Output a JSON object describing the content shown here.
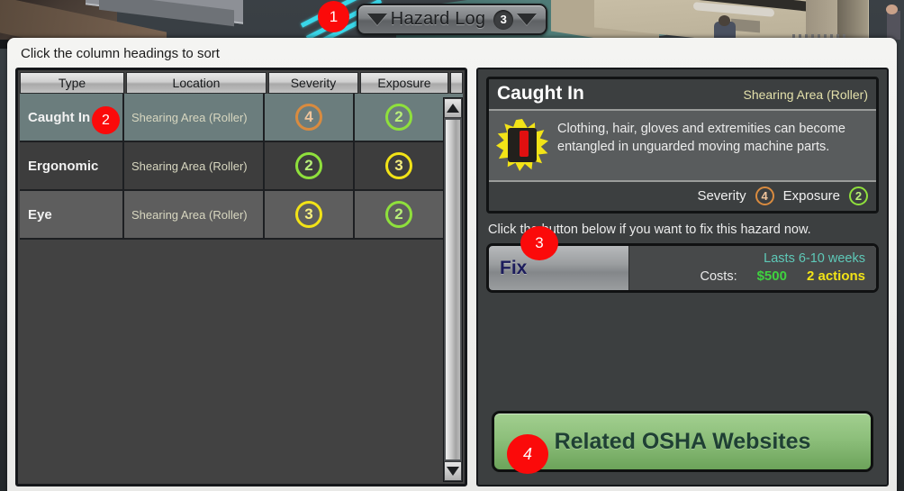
{
  "tab": {
    "prev_icon": "chevron-left-icon",
    "next_icon": "chevron-right-icon",
    "title": "Hazard Log",
    "count": "3"
  },
  "markers": {
    "one": "1",
    "two": "2",
    "three": "3",
    "four": "4"
  },
  "panel": {
    "hint": "Click the column headings to sort"
  },
  "table": {
    "columns": [
      "Type",
      "Location",
      "Severity",
      "Exposure"
    ],
    "rows": [
      {
        "type": "Caught In",
        "location": "Shearing Area (Roller)",
        "severity": "4",
        "severity_color": "#d98b3f",
        "severity_text_color": "#f0c59c",
        "exposure": "2",
        "exposure_color": "#8fe03c",
        "exposure_text_color": "#b9ef7a",
        "selected": true
      },
      {
        "type": "Ergonomic",
        "location": "Shearing Area (Roller)",
        "severity": "2",
        "severity_color": "#8fe03c",
        "severity_text_color": "#b9ef7a",
        "exposure": "3",
        "exposure_color": "#f2e317",
        "exposure_text_color": "#f7ef80",
        "selected": false
      },
      {
        "type": "Eye",
        "location": "Shearing Area (Roller)",
        "severity": "3",
        "severity_color": "#f2e317",
        "severity_text_color": "#f7ef80",
        "exposure": "2",
        "exposure_color": "#8fe03c",
        "exposure_text_color": "#b9ef7a",
        "selected": false
      }
    ]
  },
  "scrollbar": {
    "up_icon": "scroll-up-arrow-icon",
    "down_icon": "scroll-down-arrow-icon"
  },
  "detail": {
    "title": "Caught In",
    "location": "Shearing Area (Roller)",
    "warning_icon": "warning-starburst-icon",
    "description": "Clothing, hair, gloves and extremities can become entangled in unguarded moving machine parts.",
    "severity_label": "Severity",
    "severity_value": "4",
    "severity_color": "#d98b3f",
    "severity_text_color": "#f0c59c",
    "exposure_label": "Exposure",
    "exposure_value": "2",
    "exposure_color": "#8fe03c",
    "exposure_text_color": "#b9ef7a"
  },
  "fix": {
    "hint": "Click the button below if you want to fix this hazard now.",
    "button_label": "Fix",
    "duration": "Lasts 6-10 weeks",
    "costs_label": "Costs:",
    "money": "$500",
    "actions": "2 actions"
  },
  "osha": {
    "label": "Related OSHA Websites"
  }
}
